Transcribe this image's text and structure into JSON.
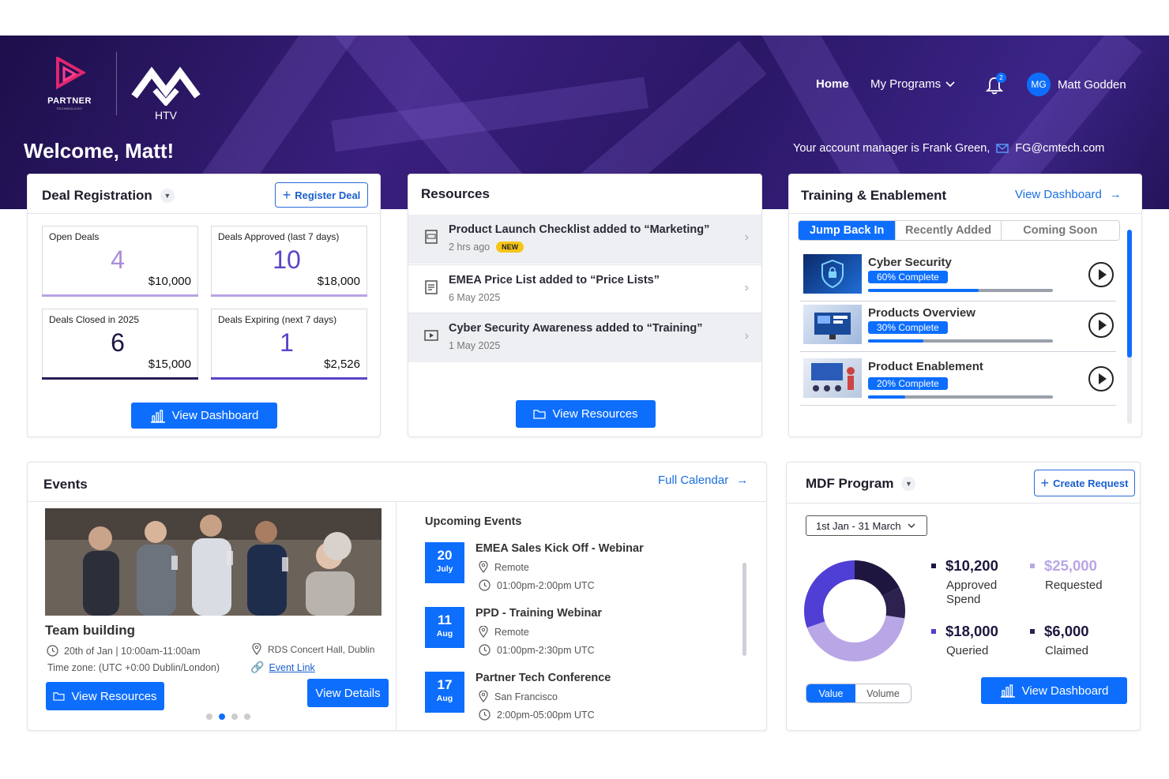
{
  "brand": {
    "partner_logo_text": "PARTNER",
    "partner_logo_sub": "TECHNOLOGY",
    "htv_logo_text": "HTV"
  },
  "nav": {
    "home": "Home",
    "programs": "My Programs",
    "notification_count": "2",
    "user_initials": "MG",
    "user_name": "Matt Godden"
  },
  "welcome": "Welcome, Matt!",
  "account_manager": {
    "text": "Your account manager is Frank Green,",
    "email": "FG@cmtech.com"
  },
  "deal_registration": {
    "title": "Deal Registration",
    "register_btn": "Register Deal",
    "stats": [
      {
        "label": "Open Deals",
        "count": "4",
        "amount": "$10,000",
        "color": "#a98bd8"
      },
      {
        "label": "Deals Approved (last 7 days)",
        "count": "10",
        "amount": "$18,000",
        "color": "#5b43c8"
      },
      {
        "label": "Deals Closed in 2025",
        "count": "6",
        "amount": "$15,000",
        "color": "#1f1640"
      },
      {
        "label": "Deals Expiring (next 7 days)",
        "count": "1",
        "amount": "$2,526",
        "color": "#5b43c8"
      }
    ],
    "view_btn": "View Dashboard"
  },
  "resources": {
    "title": "Resources",
    "items": [
      {
        "title": "Product Launch Checklist added to “Marketing”",
        "date": "2 hrs ago",
        "badge": "NEW",
        "icon": "pdf-icon"
      },
      {
        "title": "EMEA Price List added to “Price Lists”",
        "date": "6 May 2025",
        "badge": "",
        "icon": "document-icon"
      },
      {
        "title": "Cyber Security Awareness added to “Training”",
        "date": "1 May 2025",
        "badge": "",
        "icon": "video-icon"
      }
    ],
    "view_btn": "View Resources"
  },
  "training": {
    "title": "Training & Enablement",
    "view_link": "View Dashboard",
    "tabs": [
      "Jump Back In",
      "Recently Added",
      "Coming Soon"
    ],
    "courses": [
      {
        "name": "Cyber Security",
        "progress_label": "60% Complete",
        "progress": 0.6
      },
      {
        "name": "Products Overview",
        "progress_label": "30% Complete",
        "progress": 0.3
      },
      {
        "name": "Product Enablement",
        "progress_label": "20% Complete",
        "progress": 0.2
      }
    ]
  },
  "events": {
    "title": "Events",
    "calendar_link": "Full Calendar",
    "featured": {
      "name": "Team building",
      "datetime": "20th of Jan | 10:00am-11:00am",
      "timezone": "Time zone: (UTC +0:00 Dublin/London)",
      "venue": "RDS Concert Hall, Dublin",
      "event_link": "Event Link",
      "resources_btn": "View Resources",
      "details_btn": "View Details"
    },
    "upcoming_title": "Upcoming Events",
    "upcoming": [
      {
        "day": "20",
        "month": "July",
        "name": "EMEA Sales Kick Off - Webinar",
        "location": "Remote",
        "time": "01:00pm-2:00pm UTC"
      },
      {
        "day": "11",
        "month": "Aug",
        "name": "PPD - Training Webinar",
        "location": "Remote",
        "time": "01:00pm-2:30pm UTC"
      },
      {
        "day": "17",
        "month": "Aug",
        "name": "Partner Tech Conference",
        "location": "San Francisco",
        "time": "2:00pm-05:00pm UTC"
      }
    ]
  },
  "mdf": {
    "title": "MDF Program",
    "create_btn": "Create Request",
    "period": "1st Jan - 31 March",
    "items": [
      {
        "value": "$10,200",
        "label": "Approved Spend",
        "color": "#1f1640"
      },
      {
        "value": "$25,000",
        "label": "Requested",
        "color": "#b9a6e6"
      },
      {
        "value": "$18,000",
        "label": "Queried",
        "color": "#4f3fd4"
      },
      {
        "value": "$6,000",
        "label": "Claimed",
        "color": "#2d2150"
      }
    ],
    "toggle": [
      "Value",
      "Volume"
    ],
    "view_btn": "View Dashboard"
  },
  "chart_data": {
    "type": "pie",
    "categories": [
      "Approved Spend",
      "Requested",
      "Queried",
      "Claimed"
    ],
    "values": [
      10200,
      25000,
      18000,
      6000
    ],
    "colors": [
      "#1f1640",
      "#b9a6e6",
      "#4f3fd4",
      "#2d2150"
    ]
  }
}
